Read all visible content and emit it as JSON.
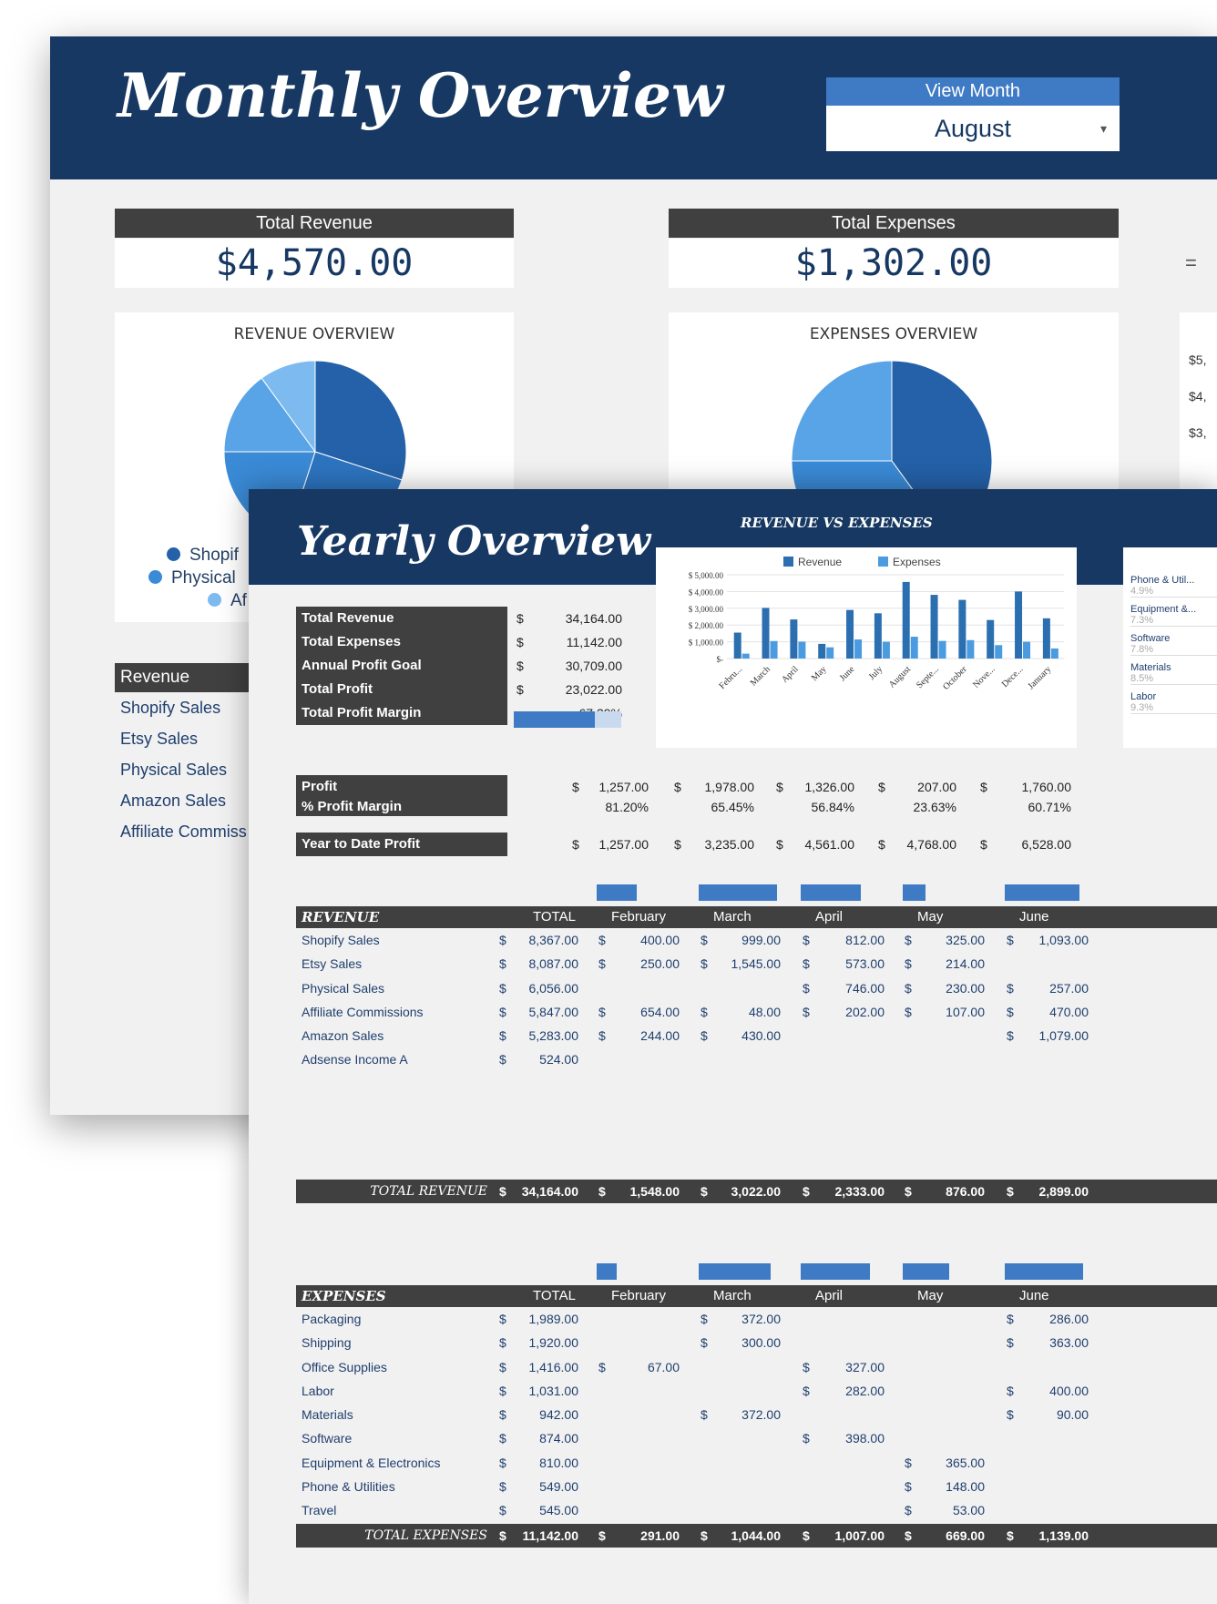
{
  "monthly": {
    "title": "Monthly Overview",
    "view_month_label": "View Month",
    "selected_month": "August",
    "total_revenue_label": "Total Revenue",
    "total_revenue_value": "$4,570.00",
    "total_expenses_label": "Total Expenses",
    "total_expenses_value": "$1,302.00",
    "equals_sign": "=",
    "revenue_overview_title": "REVENUE OVERVIEW",
    "expenses_overview_title": "EXPENSES OVERVIEW",
    "right_axis_ticks": [
      "$5,",
      "$4,",
      "$3,"
    ],
    "legend_fragments": [
      "Shopif",
      "Physical",
      "Af"
    ],
    "revenue_list": {
      "header": "Revenue",
      "items": [
        "Shopify Sales",
        "Etsy Sales",
        "Physical Sales",
        "Amazon Sales",
        "Affiliate Commiss"
      ]
    },
    "colors": {
      "navy": "#163862",
      "blue": "#3f7bc4",
      "dark_gray": "#404040"
    }
  },
  "yearly": {
    "title": "Yearly Overview",
    "chart_title": "REVENUE VS EXPENSES",
    "summary": [
      {
        "label": "Total Revenue",
        "currency": "$",
        "value": "34,164.00"
      },
      {
        "label": "Total Expenses",
        "currency": "$",
        "value": "11,142.00"
      },
      {
        "label": "Annual Profit Goal",
        "currency": "$",
        "value": "30,709.00"
      },
      {
        "label": "Total Profit",
        "currency": "$",
        "value": "23,022.00"
      },
      {
        "label": "Total Profit Margin",
        "currency": "",
        "value": "67.39%"
      }
    ],
    "profit_goal_progress": 0.75,
    "expense_pie_legend": [
      {
        "label": "Phone & Util...",
        "pct": "4.9%"
      },
      {
        "label": "Equipment &...",
        "pct": "7.3%"
      },
      {
        "label": "Software",
        "pct": "7.8%"
      },
      {
        "label": "Materials",
        "pct": "8.5%"
      },
      {
        "label": "Labor",
        "pct": "9.3%"
      }
    ],
    "profit_label": "Profit",
    "profit_margin_label": "% Profit Margin",
    "ytd_label": "Year to Date Profit",
    "profit_values": [
      "1,257.00",
      "1,978.00",
      "1,326.00",
      "207.00",
      "1,760.00"
    ],
    "profit_margins": [
      "81.20%",
      "65.45%",
      "56.84%",
      "23.63%",
      "60.71%"
    ],
    "ytd_values": [
      "1,257.00",
      "3,235.00",
      "4,561.00",
      "4,768.00",
      "6,528.00"
    ],
    "revenue_table": {
      "header": "REVENUE",
      "total_col": "TOTAL",
      "months": [
        "February",
        "March",
        "April",
        "May",
        "June"
      ],
      "rows": [
        {
          "name": "Shopify Sales",
          "total": "8,367.00",
          "vals": [
            "400.00",
            "999.00",
            "812.00",
            "325.00",
            "1,093.00"
          ]
        },
        {
          "name": "Etsy Sales",
          "total": "8,087.00",
          "vals": [
            "250.00",
            "1,545.00",
            "573.00",
            "214.00",
            ""
          ]
        },
        {
          "name": "Physical Sales",
          "total": "6,056.00",
          "vals": [
            "",
            "",
            "746.00",
            "230.00",
            "257.00"
          ]
        },
        {
          "name": "Affiliate Commissions",
          "total": "5,847.00",
          "vals": [
            "654.00",
            "48.00",
            "202.00",
            "107.00",
            "470.00"
          ]
        },
        {
          "name": "Amazon Sales",
          "total": "5,283.00",
          "vals": [
            "244.00",
            "430.00",
            "",
            "",
            "1,079.00"
          ]
        },
        {
          "name": "Adsense Income A",
          "total": "524.00",
          "vals": [
            "",
            "",
            "",
            "",
            ""
          ]
        }
      ],
      "total_label": "TOTAL REVENUE",
      "total_value": "34,164.00",
      "month_totals": [
        "1,548.00",
        "3,022.00",
        "2,333.00",
        "876.00",
        "2,899.00"
      ]
    },
    "expenses_table": {
      "header": "EXPENSES",
      "total_col": "TOTAL",
      "months": [
        "February",
        "March",
        "April",
        "May",
        "June"
      ],
      "rows": [
        {
          "name": "Packaging",
          "total": "1,989.00",
          "vals": [
            "",
            "372.00",
            "",
            "",
            "286.00"
          ]
        },
        {
          "name": "Shipping",
          "total": "1,920.00",
          "vals": [
            "",
            "300.00",
            "",
            "",
            "363.00"
          ]
        },
        {
          "name": "Office Supplies",
          "total": "1,416.00",
          "vals": [
            "67.00",
            "",
            "327.00",
            "",
            ""
          ]
        },
        {
          "name": "Labor",
          "total": "1,031.00",
          "vals": [
            "",
            "",
            "282.00",
            "",
            "400.00"
          ]
        },
        {
          "name": "Materials",
          "total": "942.00",
          "vals": [
            "",
            "372.00",
            "",
            "",
            "90.00"
          ]
        },
        {
          "name": "Software",
          "total": "874.00",
          "vals": [
            "",
            "",
            "398.00",
            "",
            ""
          ]
        },
        {
          "name": "Equipment & Electronics",
          "total": "810.00",
          "vals": [
            "",
            "",
            "",
            "365.00",
            ""
          ]
        },
        {
          "name": "Phone & Utilities",
          "total": "549.00",
          "vals": [
            "",
            "",
            "",
            "148.00",
            ""
          ]
        },
        {
          "name": "Travel",
          "total": "545.00",
          "vals": [
            "",
            "",
            "",
            "53.00",
            ""
          ]
        }
      ],
      "total_label": "TOTAL EXPENSES",
      "total_value": "11,142.00",
      "month_totals": [
        "291.00",
        "1,044.00",
        "1,007.00",
        "669.00",
        "1,139.00"
      ]
    }
  },
  "chart_data": [
    {
      "type": "bar",
      "title": "REVENUE VS EXPENSES",
      "categories": [
        "February",
        "March",
        "April",
        "May",
        "June",
        "July",
        "August",
        "September",
        "October",
        "November",
        "December",
        "January"
      ],
      "tick_labels": [
        "Febru...",
        "March",
        "April",
        "May",
        "June",
        "July",
        "August",
        "Septe...",
        "October",
        "Nove...",
        "Dece...",
        "January"
      ],
      "series": [
        {
          "name": "Revenue",
          "values": [
            1548,
            3022,
            2333,
            876,
            2899,
            2700,
            4570,
            3800,
            3500,
            2300,
            4000,
            2400
          ],
          "color": "#2c6fb0"
        },
        {
          "name": "Expenses",
          "values": [
            291,
            1044,
            1007,
            669,
            1139,
            1000,
            1302,
            1050,
            1100,
            800,
            1000,
            600
          ],
          "color": "#4a9be0"
        }
      ],
      "yticks": [
        "$ 5,000.00",
        "$ 4,000.00",
        "$ 3,000.00",
        "$ 2,000.00",
        "$ 1,000.00",
        "$-"
      ],
      "ylim": [
        0,
        5000
      ],
      "legend": "top"
    },
    {
      "type": "pie",
      "title": "REVENUE OVERVIEW",
      "labels": [
        "Shopify Sales",
        "Physical Sales",
        "Affiliate Commissions"
      ],
      "values": [
        30,
        25,
        20,
        15,
        10
      ],
      "colors": [
        "#2461a8",
        "#2d74c0",
        "#3a8ad6",
        "#58a4e6",
        "#7dbaf0"
      ]
    },
    {
      "type": "pie",
      "title": "EXPENSES OVERVIEW",
      "values": [
        40,
        35,
        25
      ],
      "colors": [
        "#2461a8",
        "#3a8ad6",
        "#58a4e6"
      ]
    }
  ]
}
